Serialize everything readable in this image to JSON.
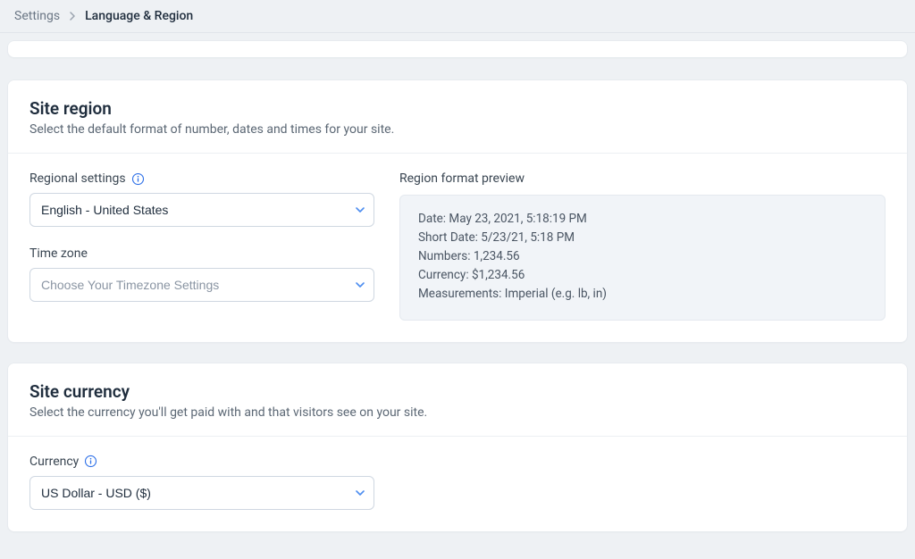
{
  "breadcrumb": {
    "parent": "Settings",
    "current": "Language & Region"
  },
  "region_card": {
    "title": "Site region",
    "subtitle": "Select the default format of number, dates and times for your site.",
    "regional_settings_label": "Regional settings",
    "regional_settings_value": "English - United States",
    "timezone_label": "Time zone",
    "timezone_placeholder": "Choose Your Timezone Settings",
    "preview_label": "Region format preview",
    "preview": {
      "date_key": "Date:",
      "date_val": "May 23, 2021, 5:18:19 PM",
      "short_key": "Short Date:",
      "short_val": "5/23/21, 5:18 PM",
      "numbers_key": "Numbers:",
      "numbers_val": "1,234.56",
      "currency_key": "Currency:",
      "currency_val": "$1,234.56",
      "meas_key": "Measurements:",
      "meas_val": "Imperial (e.g. lb, in)"
    }
  },
  "currency_card": {
    "title": "Site currency",
    "subtitle": "Select the currency you'll get paid with and that visitors see on your site.",
    "currency_label": "Currency",
    "currency_value": "US Dollar - USD ($)"
  }
}
